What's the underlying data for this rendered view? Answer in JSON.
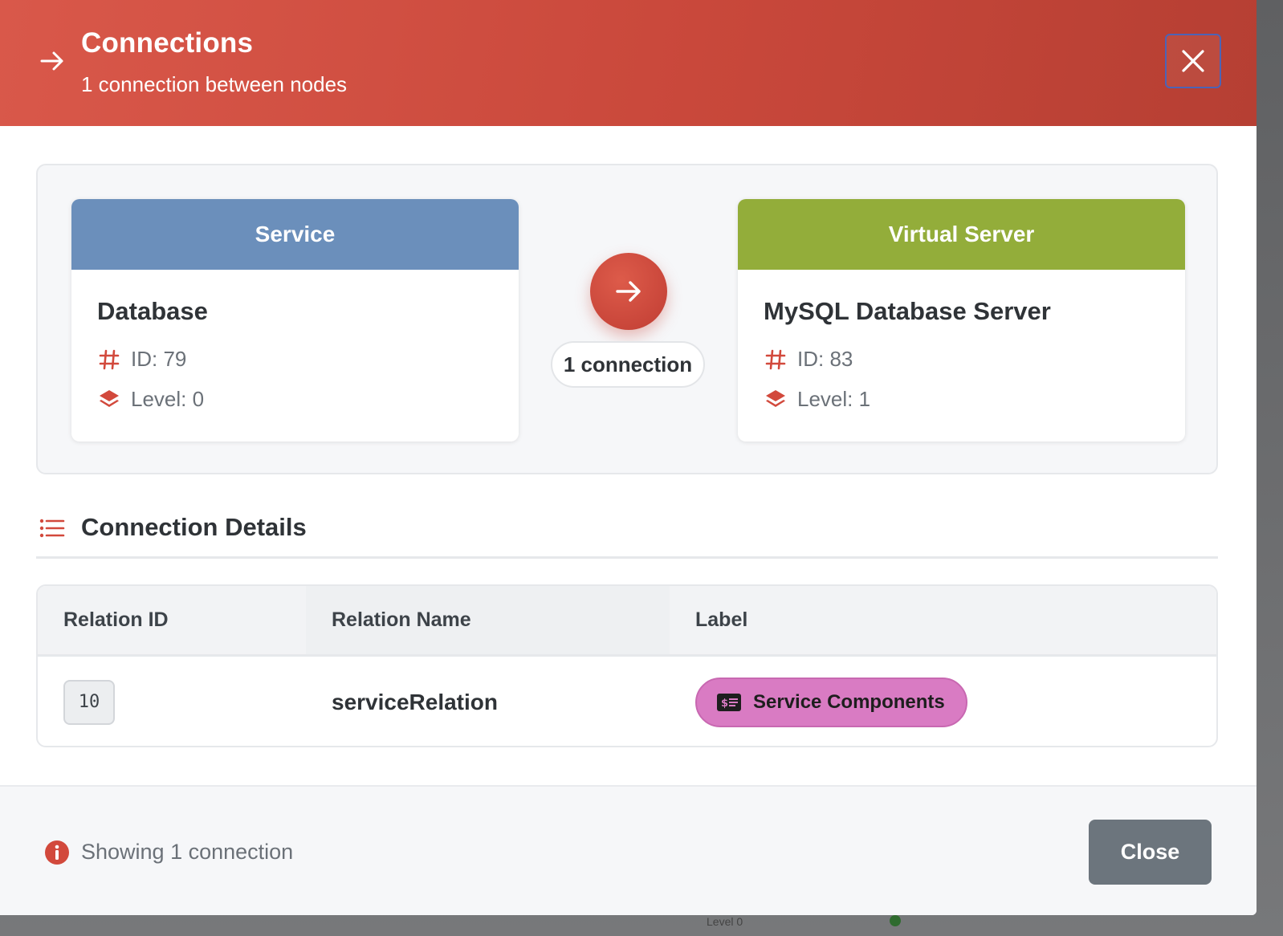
{
  "colors": {
    "header_gradient_start": "#d9584a",
    "header_gradient_end": "#b63f33",
    "service_header": "#6b8fbb",
    "virtual_server_header": "#93ad3a",
    "accent_red": "#d2493c",
    "label_pill": "#d97bc3",
    "close_button": "#6c757d"
  },
  "header": {
    "icon": "arrow-right-icon",
    "title": "Connections",
    "subtitle": "1 connection between nodes",
    "close_icon": "close-icon"
  },
  "source_node": {
    "type": "Service",
    "name": "Database",
    "id_text": "ID: 79",
    "level_text": "Level: 0",
    "id_icon": "hash-icon",
    "level_icon": "layers-icon"
  },
  "target_node": {
    "type": "Virtual Server",
    "name": "MySQL Database Server",
    "id_text": "ID: 83",
    "level_text": "Level: 1",
    "id_icon": "hash-icon",
    "level_icon": "layers-icon"
  },
  "connector": {
    "icon": "arrow-right-icon",
    "count_label": "1 connection"
  },
  "details": {
    "icon": "list-icon",
    "title": "Connection Details",
    "columns": [
      "Relation ID",
      "Relation Name",
      "Label"
    ],
    "rows": [
      {
        "relation_id": "10",
        "relation_name": "serviceRelation",
        "label": "Service Components",
        "label_icon": "money-card-icon"
      }
    ]
  },
  "footer": {
    "info_icon": "info-icon",
    "status_text": "Showing 1 connection",
    "close_label": "Close"
  },
  "background": {
    "peek_text": "Level 0"
  }
}
